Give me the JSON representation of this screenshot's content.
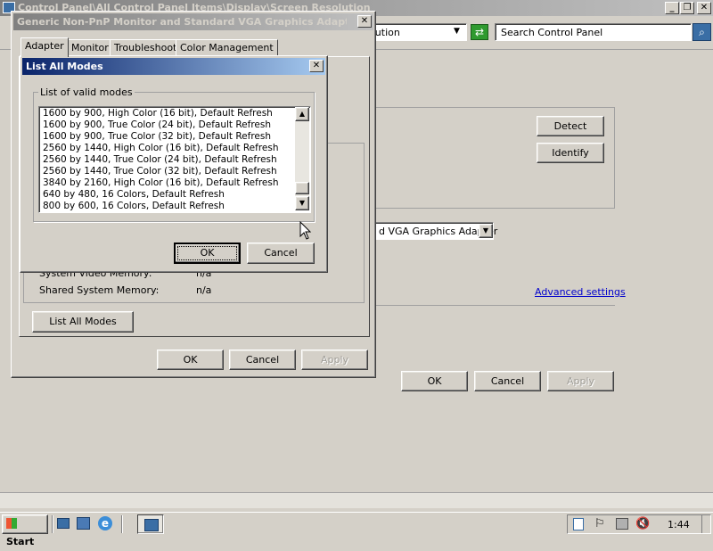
{
  "bg_window": {
    "title": "Control Panel\\All Control Panel Items\\Display\\Screen Resolution",
    "address_text": "olution",
    "search_placeholder": "Search Control Panel",
    "detect_label": "Detect",
    "identify_label": "Identify",
    "adapter_select_value": "d VGA Graphics Adapter",
    "advanced_settings_label": "Advanced settings",
    "ok_label": "OK",
    "cancel_label": "Cancel",
    "apply_label": "Apply"
  },
  "props_dialog": {
    "title": "Generic Non-PnP Monitor and Standard VGA Graphics Adapter Pro...",
    "tabs": [
      "Adapter",
      "Monitor",
      "Troubleshoot",
      "Color Management"
    ],
    "system_video_memory_label": "System Video Memory:",
    "system_video_memory_value": "n/a",
    "shared_memory_label": "Shared System Memory:",
    "shared_memory_value": "n/a",
    "list_all_modes_label": "List All Modes",
    "ok_label": "OK",
    "cancel_label": "Cancel",
    "apply_label": "Apply"
  },
  "modes_dialog": {
    "title": "List All Modes",
    "group_label": "List of valid modes",
    "modes": [
      "1600 by 900, High Color (16 bit), Default Refresh",
      "1600 by 900, True Color (24 bit), Default Refresh",
      "1600 by 900, True Color (32 bit), Default Refresh",
      "2560 by 1440, High Color (16 bit), Default Refresh",
      "2560 by 1440, True Color (24 bit), Default Refresh",
      "2560 by 1440, True Color (32 bit), Default Refresh",
      "3840 by 2160, High Color (16 bit), Default Refresh",
      "640 by 480, 16 Colors, Default Refresh",
      "800 by 600, 16 Colors, Default Refresh"
    ],
    "ok_label": "OK",
    "cancel_label": "Cancel"
  },
  "taskbar": {
    "start_label": "Start",
    "clock": "1:44"
  },
  "colors": {
    "active_title": "#0a246a",
    "link": "#0000cc"
  }
}
